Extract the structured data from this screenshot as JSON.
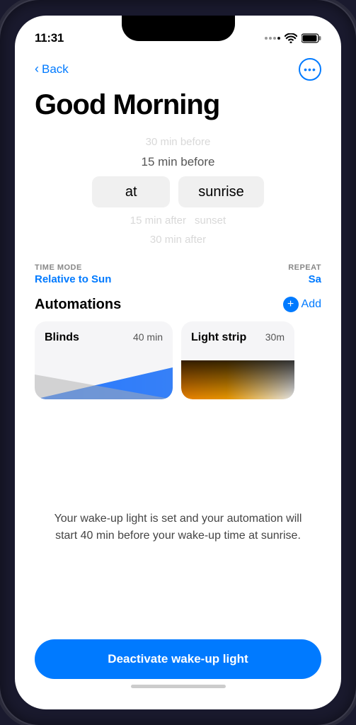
{
  "status": {
    "time": "11:31"
  },
  "nav": {
    "back_label": "Back",
    "more_label": "···"
  },
  "page": {
    "title": "Good Morning"
  },
  "time_picker": {
    "option_1": "30 min before",
    "option_2": "15 min before",
    "selected_left": "at",
    "selected_right": "sunrise",
    "option_3": "15 min after",
    "option_4": "30 min after",
    "sunset_label": "sunset"
  },
  "meta": {
    "time_mode_label": "TIME MODE",
    "time_mode_value": "Relative to Sun",
    "repeat_label": "REPEAT",
    "repeat_value": "Sa"
  },
  "automations": {
    "title": "Automations",
    "add_label": "Add",
    "cards": [
      {
        "title": "Blinds",
        "time": "40 min"
      },
      {
        "title": "Light strip",
        "time": "30m"
      }
    ]
  },
  "info": {
    "text": "Your wake-up light is set and your automation will start 40 min before your wake-up time at sunrise."
  },
  "footer": {
    "deactivate_label": "Deactivate wake-up light"
  }
}
